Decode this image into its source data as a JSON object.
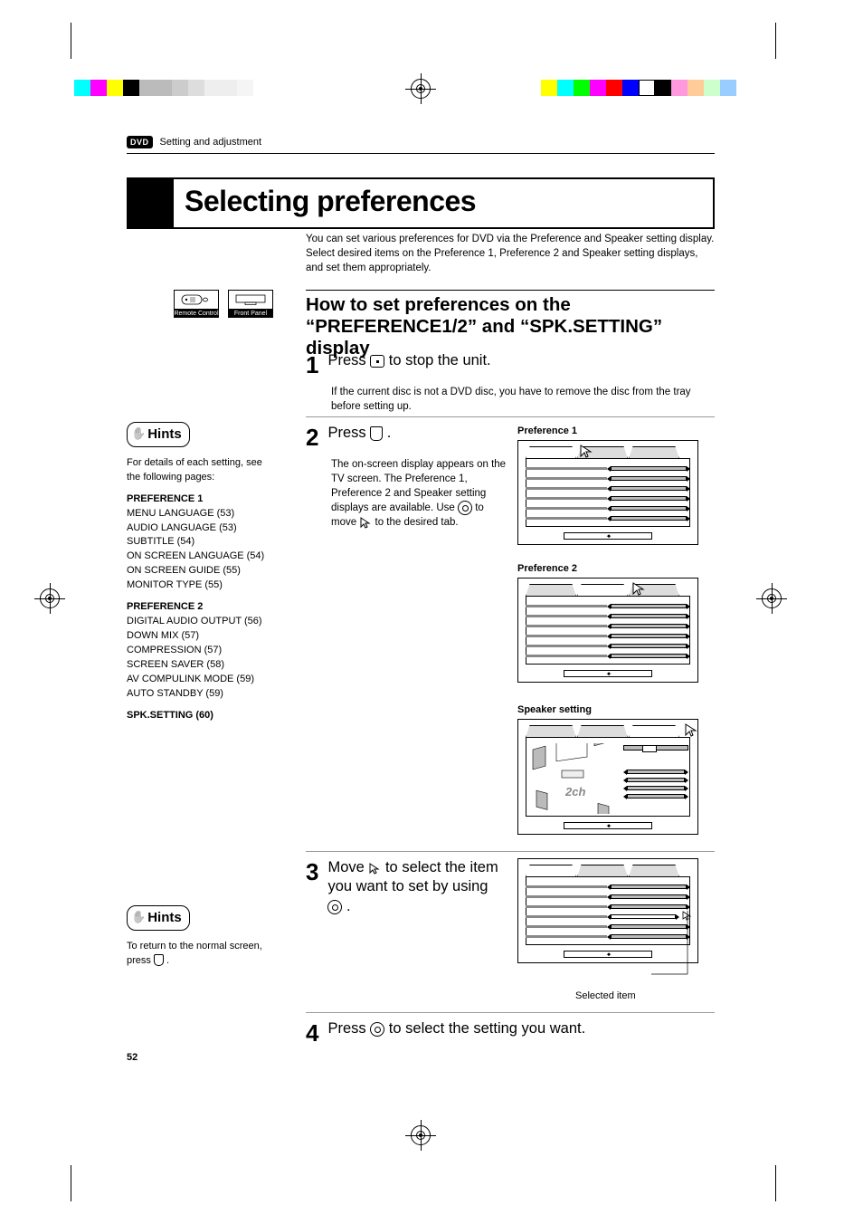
{
  "section_header": "Setting and adjustment",
  "dvd_badge": "DVD",
  "title": "Selecting preferences",
  "intro": "You can set various preferences for DVD via the Preference and Speaker setting display. Select desired items on the Preference 1, Preference 2 and Speaker setting displays, and set them appropriately.",
  "device_labels": {
    "remote": "Remote Control",
    "front": "Front Panel"
  },
  "h2": "How to set preferences on the “PREFERENCE1/2” and “SPK.SETTING” display",
  "steps": {
    "s1": {
      "num": "1",
      "head_a": "Press ",
      "head_b": " to stop the unit.",
      "body": "If the current disc is not a DVD disc, you have to remove the disc from the tray before setting up."
    },
    "s2": {
      "num": "2",
      "head_a": "Press ",
      "head_b": " .",
      "body_a": "The on-screen display appears on the TV screen. The Preference 1, Preference 2 and Speaker setting displays are available. Use ",
      "body_b": " to move ",
      "body_c": " to the desired tab."
    },
    "s3": {
      "num": "3",
      "head_a": "Move ",
      "head_b": " to select the item you want to set by using ",
      "head_c": " ."
    },
    "s4": {
      "num": "4",
      "head_a": "Press ",
      "head_b": " to select the setting you want."
    }
  },
  "hints_label": "Hints",
  "hints1": {
    "intro": "For details of each setting, see the following pages:",
    "p1_title": "PREFERENCE 1",
    "p1_items": [
      "MENU LANGUAGE (53)",
      "AUDIO LANGUAGE (53)",
      "SUBTITLE (54)",
      "ON SCREEN LANGUAGE (54)",
      "ON SCREEN GUIDE (55)",
      "MONITOR TYPE (55)"
    ],
    "p2_title": "PREFERENCE 2",
    "p2_items": [
      "DIGITAL AUDIO OUTPUT (56)",
      "DOWN MIX (57)",
      "COMPRESSION (57)",
      "SCREEN SAVER (58)",
      "AV COMPULINK MODE (59)",
      "AUTO STANDBY (59)"
    ],
    "spk_title": "SPK.SETTING (60)"
  },
  "hints2": {
    "text_a": "To return to the normal screen, press ",
    "text_b": " ."
  },
  "pref_labels": {
    "p1": "Preference 1",
    "p2": "Preference 2",
    "spk": "Speaker setting",
    "selected": "Selected item",
    "spk_2ch": "2ch"
  },
  "page_num": "52"
}
